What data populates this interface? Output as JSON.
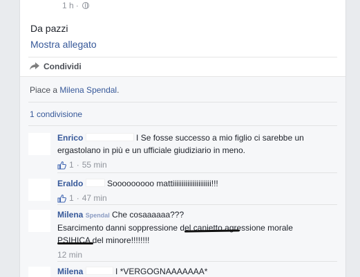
{
  "post": {
    "time": "1 h",
    "dot": "·",
    "text": "Da pazzi",
    "attachment_link": "Mostra allegato",
    "share_label": "Condividi"
  },
  "footer": {
    "likes_prefix": "Piace a",
    "liker": "Milena Spendal",
    "likes_suffix": ".",
    "shares": "1 condivisione"
  },
  "comments": [
    {
      "author": "Enrico",
      "text": "I Se fosse successo a mio figlio ci sarebbe un ergastolano in più e un ufficiale giudiziario in meno.",
      "likes": "1",
      "time": "55 min"
    },
    {
      "author": "Eraldo",
      "text": "Sooooooooo mattiiiiiiiiiiiiiiiiiiiii!!!",
      "likes": "1",
      "time": "47 min"
    },
    {
      "author": "Milena",
      "author_rest": "Spendal",
      "line1": "Che cosaaaaaa???",
      "line2": "Esarcimento danni soppressione del canietto agressione morale",
      "line3": "PSIHICA del minore!!!!!!!!",
      "time": "12 min"
    },
    {
      "author": "Milena",
      "text": "I *VERGOGNAAAAAAA*"
    }
  ],
  "colors": {
    "link": "#365899",
    "meta": "#90949c",
    "footer_bg": "#f6f7f9",
    "page_bg": "#e9ebee"
  }
}
